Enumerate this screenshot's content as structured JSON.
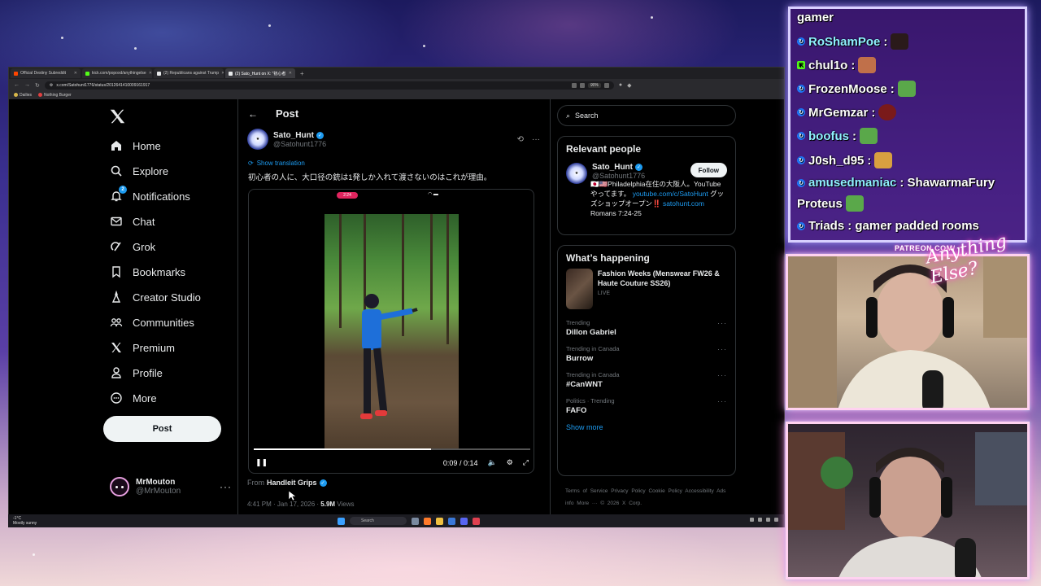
{
  "browser": {
    "tabs": [
      {
        "label": "Official Destiny Subreddit",
        "color": "#ff4500"
      },
      {
        "label": "kick.com/popoxd/anythingelse",
        "color": "#53fc18"
      },
      {
        "label": "(2) Republicans against Trump",
        "color": "#e7e9ea"
      },
      {
        "label": "(2) Sato_Hunt on X: \"初心者",
        "color": "#e7e9ea",
        "active": true
      }
    ],
    "url": "x.com/Satohunt1776/status/2012641410009161917",
    "zoom": "90%",
    "bookmarks": [
      "Dailies",
      "Nothing Burger"
    ]
  },
  "nav": {
    "items": [
      {
        "label": "Home",
        "icon": "home-icon"
      },
      {
        "label": "Explore",
        "icon": "search-icon"
      },
      {
        "label": "Notifications",
        "icon": "bell-icon",
        "badge": "2"
      },
      {
        "label": "Chat",
        "icon": "mail-icon"
      },
      {
        "label": "Grok",
        "icon": "grok-icon"
      },
      {
        "label": "Bookmarks",
        "icon": "bookmark-icon"
      },
      {
        "label": "Creator Studio",
        "icon": "creator-icon"
      },
      {
        "label": "Communities",
        "icon": "communities-icon"
      },
      {
        "label": "Premium",
        "icon": "x-logo-icon"
      },
      {
        "label": "Profile",
        "icon": "person-icon"
      },
      {
        "label": "More",
        "icon": "more-circle-icon"
      }
    ],
    "post_button": "Post",
    "user": {
      "name": "MrMouton",
      "handle": "@MrMouton"
    }
  },
  "post": {
    "header_title": "Post",
    "author_name": "Sato_Hunt",
    "author_handle": "@Satohunt1776",
    "show_translation": "Show translation",
    "text": "初心者の人に、大口径の銃は1発しか入れて渡さないのはこれが理由。",
    "video": {
      "rec_time": "2:24",
      "current": "0:09",
      "duration": "0:14",
      "progress": 0.64
    },
    "from_prefix": "From",
    "from_name": "Handleit Grips",
    "timestamp": "4:41 PM · Jan 17, 2026 · ",
    "views": "5.9M",
    "views_label": " Views"
  },
  "sidebar": {
    "search_placeholder": "Search",
    "relevant_title": "Relevant people",
    "relevant": {
      "name": "Sato_Hunt",
      "handle": "@Satohunt1776",
      "follow": "Follow",
      "bio_1": "🇯🇵🇺🇸Philadelphia在住の大阪人。YouTubeやってます。",
      "bio_link": "youtube.com/c/SatoHunt",
      "bio_2": " グッズショップオープン‼️",
      "bio_link2": "satohunt.com",
      "bio_3": " Romans 7:24-25"
    },
    "happening_title": "What’s happening",
    "news": {
      "title": "Fashion Weeks (Menswear FW26 & Haute Couture SS26)",
      "status": "LIVE"
    },
    "trends": [
      {
        "category": "Trending",
        "name": "Dillon Gabriel"
      },
      {
        "category": "Trending in Canada",
        "name": "Burrow"
      },
      {
        "category": "Trending in Canada",
        "name": "#CanWNT"
      },
      {
        "category": "Politics · Trending",
        "name": "FAFO"
      }
    ],
    "show_more": "Show more",
    "footer": "Terms of Service   Privacy Policy   Cookie Policy   Accessibility   Ads info   More ···   © 2026 X Corp."
  },
  "taskbar": {
    "weather_temp": "-1°C",
    "weather_desc": "Mostly sunny",
    "search": "Search"
  },
  "chat": {
    "title": "gamer",
    "messages": [
      {
        "user": "RoShamPoe",
        "text": ":",
        "role": "mod"
      },
      {
        "user": "chul1o",
        "text": ":",
        "role": "kick"
      },
      {
        "user": "FrozenMoose",
        "text": ":",
        "role": "mod"
      },
      {
        "user": "MrGemzar",
        "text": ":",
        "role": "mod"
      },
      {
        "user": "boofus",
        "text": ":",
        "role": "mod"
      },
      {
        "user": "J0sh_d95",
        "text": ":",
        "role": "mod"
      },
      {
        "user": "amusedmaniac",
        "text": ": ShawarmaFury",
        "role": "mod"
      },
      {
        "user": "Proteus",
        "text": "",
        "role": "none"
      },
      {
        "user": "Triads",
        "text": ": gamer padded rooms",
        "role": "mod"
      }
    ]
  },
  "overlay": {
    "patreon": "PATREON.COM/",
    "signature": "Anything Else?"
  },
  "colors": {
    "accent": "#1d9bf0",
    "bg": "#000000",
    "text": "#e7e9ea",
    "muted": "#71767b",
    "chat_border": "#d8d0ff",
    "cam_border": "#ffd2f0"
  }
}
